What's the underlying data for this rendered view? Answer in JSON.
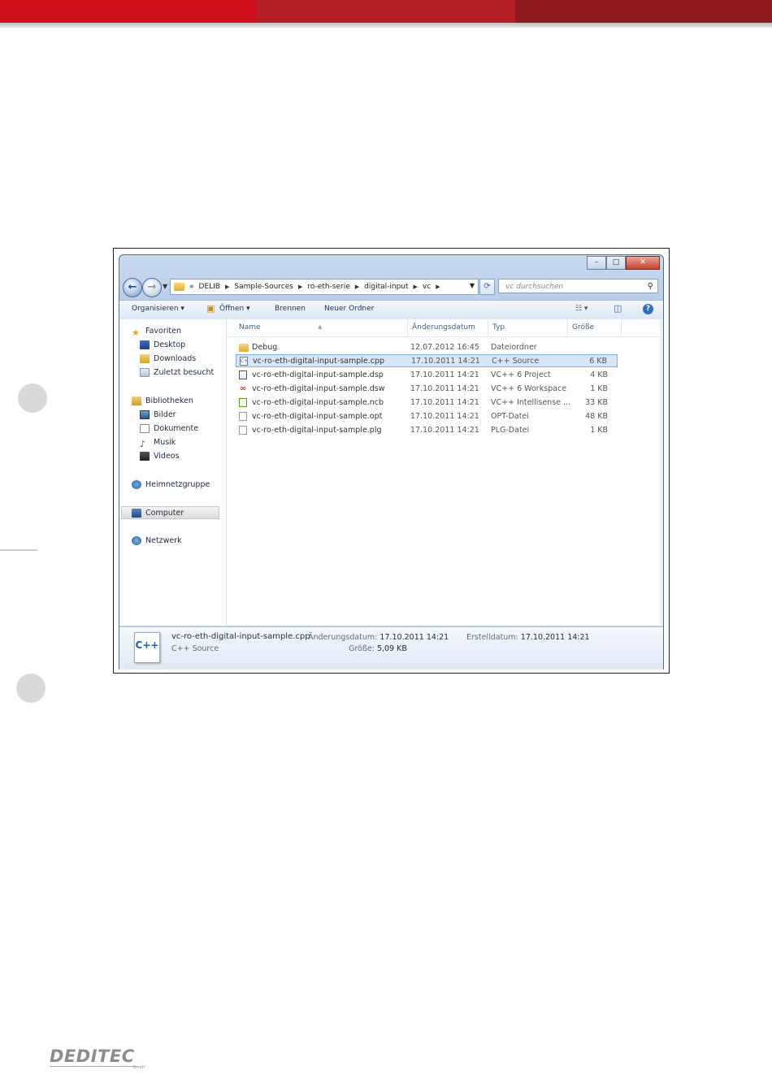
{
  "window": {
    "caption_buttons": {
      "minimize": "–",
      "maximize": "□",
      "close": "✕"
    }
  },
  "address": {
    "overflow": "«",
    "breadcrumbs": [
      "DELIB",
      "Sample-Sources",
      "ro-eth-serie",
      "digital-input",
      "vc"
    ],
    "search_placeholder": "vc durchsuchen"
  },
  "toolbar": {
    "organize": "Organisieren",
    "open": "Öffnen",
    "burn": "Brennen",
    "new_folder": "Neuer Ordner"
  },
  "sidebar": {
    "favorites": {
      "label": "Favoriten",
      "items": [
        {
          "label": "Desktop",
          "icon": "desktop-icon"
        },
        {
          "label": "Downloads",
          "icon": "downloads-icon"
        },
        {
          "label": "Zuletzt besucht",
          "icon": "recent-icon"
        }
      ]
    },
    "libraries": {
      "label": "Bibliotheken",
      "items": [
        {
          "label": "Bilder",
          "icon": "pictures-icon"
        },
        {
          "label": "Dokumente",
          "icon": "documents-icon"
        },
        {
          "label": "Musik",
          "icon": "music-icon"
        },
        {
          "label": "Videos",
          "icon": "videos-icon"
        }
      ]
    },
    "homegroup": "Heimnetzgruppe",
    "computer": "Computer",
    "network": "Netzwerk"
  },
  "files": {
    "columns": [
      "Name",
      "Änderungsdatum",
      "Typ",
      "Größe"
    ],
    "rows": [
      {
        "name": "Debug",
        "date": "12.07.2012 16:45",
        "type": "Dateiordner",
        "size": "",
        "icon": "folder-icon"
      },
      {
        "name": "vc-ro-eth-digital-input-sample.cpp",
        "date": "17.10.2011 14:21",
        "type": "C++ Source",
        "size": "6 KB",
        "icon": "cpp-file-icon",
        "selected": true
      },
      {
        "name": "vc-ro-eth-digital-input-sample.dsp",
        "date": "17.10.2011 14:21",
        "type": "VC++ 6 Project",
        "size": "4 KB",
        "icon": "dsp-file-icon"
      },
      {
        "name": "vc-ro-eth-digital-input-sample.dsw",
        "date": "17.10.2011 14:21",
        "type": "VC++ 6 Workspace",
        "size": "1 KB",
        "icon": "dsw-file-icon"
      },
      {
        "name": "vc-ro-eth-digital-input-sample.ncb",
        "date": "17.10.2011 14:21",
        "type": "VC++ Intellisense ...",
        "size": "33 KB",
        "icon": "ncb-file-icon"
      },
      {
        "name": "vc-ro-eth-digital-input-sample.opt",
        "date": "17.10.2011 14:21",
        "type": "OPT-Datei",
        "size": "48 KB",
        "icon": "opt-file-icon"
      },
      {
        "name": "vc-ro-eth-digital-input-sample.plg",
        "date": "17.10.2011 14:21",
        "type": "PLG-Datei",
        "size": "1 KB",
        "icon": "plg-file-icon"
      }
    ]
  },
  "details": {
    "icon_text": "C++",
    "filename": "vc-ro-eth-digital-input-sample.cpp",
    "filetype": "C++ Source",
    "modified_label": "Änderungsdatum:",
    "modified_value": "17.10.2011 14:21",
    "created_label": "Erstelldatum:",
    "created_value": "17.10.2011 14:21",
    "size_label": "Größe:",
    "size_value": "5,09 KB"
  },
  "logo": {
    "text": "DEDITEC",
    "sub": "GmbH"
  }
}
